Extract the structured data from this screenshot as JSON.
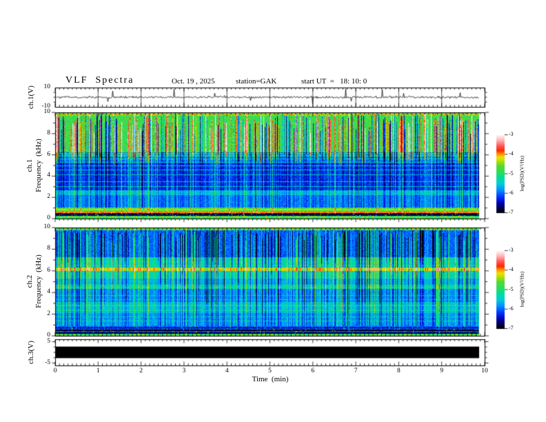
{
  "title": {
    "main": "VLF  Spectra",
    "date": "Oct. 19 , 2025",
    "station": "station=GAK",
    "start_ut": "start UT  =   18: 10: 0"
  },
  "x_axis": {
    "label": "Time  (min)",
    "ticks": [
      "0",
      "1",
      "2",
      "3",
      "4",
      "5",
      "6",
      "7",
      "8",
      "9",
      "10"
    ]
  },
  "panels": {
    "ch1_wave": {
      "ylabel": "ch.1(V)",
      "yticks": [
        "10",
        "-10"
      ]
    },
    "ch1_spec": {
      "ylabel_ch": "ch.1",
      "ylabel_freq": "Frequency  (kHz)",
      "yticks": [
        "0",
        "2",
        "4",
        "6",
        "8",
        "10"
      ]
    },
    "ch2_spec": {
      "ylabel_ch": "ch.2",
      "ylabel_freq": "Frequency  (kHz)",
      "yticks": [
        "0",
        "2",
        "4",
        "6",
        "8",
        "10"
      ]
    },
    "ch3_wave": {
      "ylabel": "ch.3(V)",
      "yticks": [
        "5",
        "-5"
      ]
    }
  },
  "colorbar": {
    "label": "log(PSD)(V²/Hz)",
    "ticks": [
      "-3",
      "-4",
      "-5",
      "-6",
      "-7"
    ]
  },
  "colors": {
    "background": "#ffffff",
    "frame": "#000000",
    "trace": "#000000",
    "colormap": [
      {
        "t": 0.0,
        "c": "#000004"
      },
      {
        "t": 0.05,
        "c": "#000040"
      },
      {
        "t": 0.12,
        "c": "#0000b0"
      },
      {
        "t": 0.2,
        "c": "#0030ff"
      },
      {
        "t": 0.29,
        "c": "#0090ff"
      },
      {
        "t": 0.37,
        "c": "#00ccd8"
      },
      {
        "t": 0.45,
        "c": "#00dc9c"
      },
      {
        "t": 0.52,
        "c": "#2ade5a"
      },
      {
        "t": 0.6,
        "c": "#55d835"
      },
      {
        "t": 0.66,
        "c": "#b0e000"
      },
      {
        "t": 0.71,
        "c": "#f0e000"
      },
      {
        "t": 0.755,
        "c": "#ff9000"
      },
      {
        "t": 0.8,
        "c": "#ff2800"
      },
      {
        "t": 0.86,
        "c": "#ff5a5a"
      },
      {
        "t": 0.93,
        "c": "#ffb4b4"
      },
      {
        "t": 1.0,
        "c": "#fffafa"
      }
    ]
  },
  "chart_data": [
    {
      "type": "line",
      "name": "ch.1 voltage waveform",
      "ylabel": "ch.1(V)",
      "x_range": [
        0,
        9.86
      ],
      "y_range": [
        -10,
        10
      ],
      "baseline": 0,
      "noise_sigma": 1.2,
      "spike_prob": 0.012,
      "spike_amp_max": 8.5,
      "grid": "vertical lines at every minute"
    },
    {
      "type": "heatmap",
      "name": "ch.1 spectrogram",
      "xlabel": "Time (min)",
      "ylabel": "ch.1 Frequency (kHz)",
      "x_range": [
        0,
        9.86
      ],
      "y_range": [
        0,
        10
      ],
      "z_label": "log(PSD)(V²/Hz)",
      "z_range": [
        -7,
        -3
      ],
      "bands": [
        {
          "f": [
            0,
            0.25
          ],
          "psd": -4.9,
          "var": 0.9,
          "hot": 0.15
        },
        {
          "f": [
            0.25,
            0.5
          ],
          "psd": -6.7,
          "var": 0.45,
          "hot": 0.06
        },
        {
          "f": [
            0.5,
            1.0
          ],
          "psd": -4.75,
          "var": 0.3
        },
        {
          "f": [
            1.0,
            2.2
          ],
          "psd": -5.95,
          "var": 0.3
        },
        {
          "f": [
            2.2,
            2.65
          ],
          "psd": -5.6,
          "var": 0.25
        },
        {
          "f": [
            2.65,
            5.3
          ],
          "psd": -6.25,
          "var": 0.35
        },
        {
          "f": [
            5.3,
            6.3
          ],
          "psd": -5.95,
          "var": 0.35
        },
        {
          "f": [
            6.3,
            9.8
          ],
          "psd": -4.8,
          "var": 0.45
        },
        {
          "f": [
            9.8,
            10
          ],
          "psd": -4.4,
          "var": 0.9,
          "hot": 0.2
        }
      ],
      "hlines": [
        {
          "f": 0.3,
          "psd": -6.9,
          "hw": 0.07
        },
        {
          "f": 0.55,
          "psd": -3.95,
          "hw": 0.05
        },
        {
          "f": 0.8,
          "psd": -4.35,
          "hw": 0.06
        },
        {
          "f": 3.05,
          "psd": -5.5,
          "hw": 0.04
        },
        {
          "f": 3.5,
          "psd": -5.5,
          "hw": 0.04
        },
        {
          "f": 4.15,
          "psd": -5.45,
          "hw": 0.04
        },
        {
          "f": 4.6,
          "psd": -5.5,
          "hw": 0.04
        },
        {
          "f": 5.0,
          "psd": -5.45,
          "hw": 0.04
        },
        {
          "f": 5.35,
          "psd": -5.4,
          "hw": 0.04
        },
        {
          "f": 5.65,
          "psd": -5.4,
          "hw": 0.04
        },
        {
          "f": 5.95,
          "psd": -5.35,
          "hw": 0.04
        },
        {
          "f": 6.15,
          "psd": -5.3,
          "hw": 0.04
        }
      ],
      "streaks": {
        "bright_prob": 0.3,
        "bright_amp": [
          0.5,
          1.9
        ],
        "dark_prob": 0.25,
        "dark_amp": [
          0.7,
          2.0
        ],
        "upper_from": 6.3,
        "dip": 1.2,
        "top_gap": 2.5,
        "low_prob": 0.1,
        "low_amp": 0.55,
        "mid_scale": 0.25,
        "mid_from": 0.9
      }
    },
    {
      "type": "heatmap",
      "name": "ch.2 spectrogram",
      "xlabel": "Time (min)",
      "ylabel": "ch.2 Frequency (kHz)",
      "x_range": [
        0,
        9.86
      ],
      "y_range": [
        0,
        10
      ],
      "z_label": "log(PSD)(V²/Hz)",
      "z_range": [
        -7,
        -3
      ],
      "bands": [
        {
          "f": [
            0,
            0.15
          ],
          "psd": -4.9,
          "var": 0.9,
          "hot": 0.15
        },
        {
          "f": [
            0.15,
            0.85
          ],
          "psd": -6.1,
          "var": 0.35,
          "hot": 0.02
        },
        {
          "f": [
            0.85,
            2.1
          ],
          "psd": -5.8,
          "var": 0.3
        },
        {
          "f": [
            2.1,
            3.1
          ],
          "psd": -5.55,
          "var": 0.25
        },
        {
          "f": [
            3.1,
            4.35
          ],
          "psd": -5.85,
          "var": 0.3
        },
        {
          "f": [
            4.35,
            4.75
          ],
          "psd": -5.3,
          "var": 0.25
        },
        {
          "f": [
            4.75,
            5.3
          ],
          "psd": -5.65,
          "var": 0.25,
          "striated": true
        },
        {
          "f": [
            5.3,
            6.05
          ],
          "psd": -5.3,
          "var": 0.25,
          "striated": true
        },
        {
          "f": [
            6.05,
            6.35
          ],
          "psd": -4.2,
          "var": 0.25
        },
        {
          "f": [
            6.35,
            7.3
          ],
          "psd": -5.35,
          "var": 0.3,
          "striated": true
        },
        {
          "f": [
            7.3,
            9.85
          ],
          "psd": -6.0,
          "var": 0.35
        },
        {
          "f": [
            9.85,
            10
          ],
          "psd": -4.8,
          "var": 0.9,
          "hot": 0.15
        }
      ],
      "hlines": [
        {
          "f": 0.25,
          "psd": -6.95,
          "hw": 0.07
        },
        {
          "f": 0.5,
          "psd": -6.95,
          "hw": 0.07
        },
        {
          "f": 0.72,
          "psd": -6.9,
          "hw": 0.05
        },
        {
          "f": 1.35,
          "psd": -5.4,
          "hw": 0.04
        },
        {
          "f": 1.75,
          "psd": -5.45,
          "hw": 0.04
        },
        {
          "f": 2.35,
          "psd": -5.3,
          "hw": 0.04
        },
        {
          "f": 2.8,
          "psd": -5.2,
          "hw": 0.09
        },
        {
          "f": 3.35,
          "psd": -5.5,
          "hw": 0.04
        },
        {
          "f": 3.75,
          "psd": -5.5,
          "hw": 0.04
        },
        {
          "f": 4.5,
          "psd": -5.15,
          "hw": 0.06
        },
        {
          "f": 6.55,
          "psd": -5.15,
          "hw": 0.04
        },
        {
          "f": 6.9,
          "psd": -5.2,
          "hw": 0.04
        }
      ],
      "streaks": {
        "bright_prob": 0.26,
        "bright_amp": [
          0.45,
          1.15
        ],
        "dark_prob": 0.22,
        "dark_amp": [
          0.5,
          1.3
        ],
        "upper_from": 7.3,
        "dip": 5.5,
        "top_gap": 1.5,
        "low_prob": 0.06,
        "low_amp": 0.4,
        "mid_scale": 0.5,
        "mid_from": 0.9
      }
    },
    {
      "type": "line",
      "name": "ch.3 voltage waveform",
      "ylabel": "ch.3(V)",
      "x_range": [
        0,
        9.86
      ],
      "y_range": [
        -5,
        5
      ],
      "flat_value": 0,
      "thickness": 0.9
    }
  ]
}
